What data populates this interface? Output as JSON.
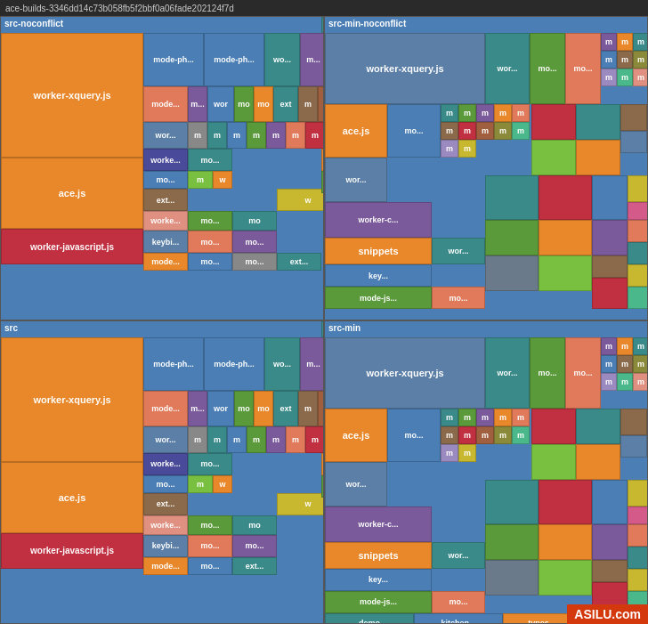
{
  "title": "ace-builds-3346dd14c73b058fb5f2bbf0a06fade202124f7d",
  "quadrants": [
    {
      "id": "q1",
      "label": "src-noconflict",
      "position": "top-left"
    },
    {
      "id": "q2",
      "label": "src-min-noconflict",
      "position": "top-right"
    },
    {
      "id": "q3",
      "label": "src",
      "position": "bottom-left"
    },
    {
      "id": "q4",
      "label": "src-min",
      "position": "bottom-right"
    }
  ],
  "bottom_labels": [
    "demo",
    "kitchen...",
    "types"
  ],
  "watermark": "ASILU.com"
}
